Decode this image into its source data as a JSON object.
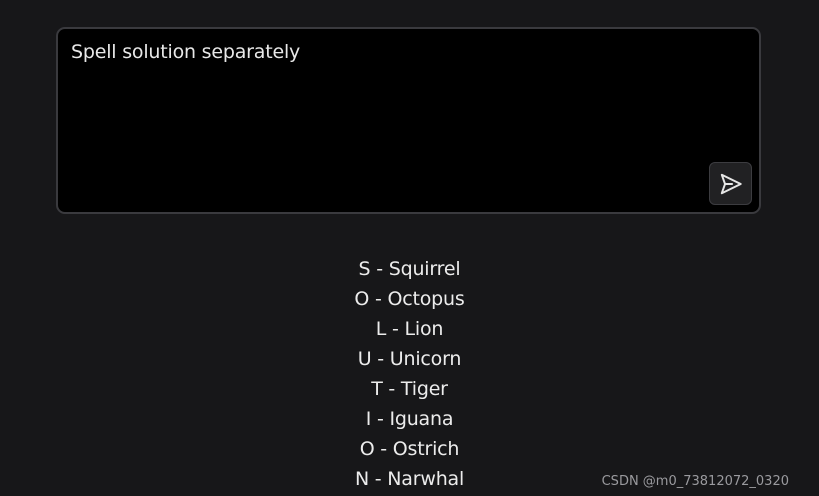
{
  "prompt": {
    "text": "Spell solution separately",
    "send_icon": "send-icon"
  },
  "answer": {
    "lines": [
      "S - Squirrel",
      "O - Octopus",
      "L - Lion",
      "U - Unicorn",
      "T - Tiger",
      "I - Iguana",
      "O - Ostrich",
      "N - Narwhal"
    ]
  },
  "watermark": {
    "text": "CSDN @m0_73812072_0320"
  },
  "colors": {
    "background": "#171719",
    "input_background": "#000000",
    "input_border": "#3a3a3e",
    "text": "#ececec"
  }
}
